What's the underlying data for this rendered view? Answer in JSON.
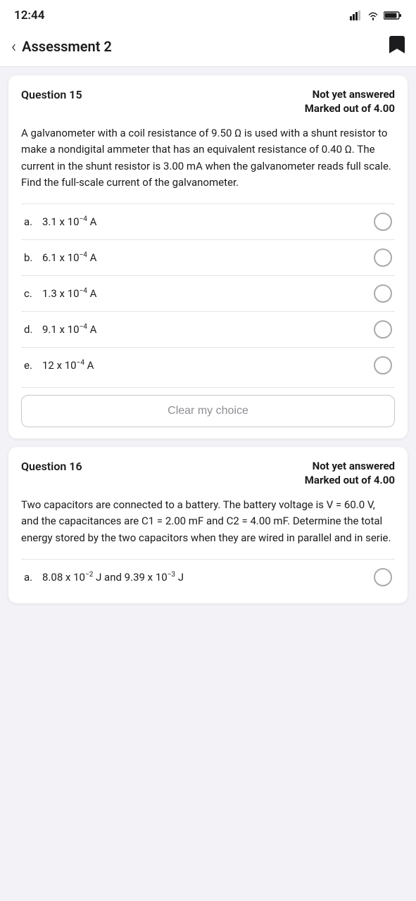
{
  "statusBar": {
    "time": "12:44",
    "icons": [
      "signal",
      "wifi",
      "battery"
    ]
  },
  "header": {
    "backLabel": "<",
    "title": "Assessment 2",
    "bookmarkIcon": "bookmark"
  },
  "question15": {
    "label": "Question 15",
    "statusLine1": "Not yet answered",
    "statusLine2": "Marked out of 4.00",
    "questionText": "A galvanometer with a coil resistance of 9.50 Ω is used with a shunt resistor to make a nondigital ammeter that has an equivalent resistance of 0.40 Ω. The current in the shunt resistor is 3.00 mA when the galvanometer reads full scale. Find the full-scale current of the galvanometer.",
    "options": [
      {
        "letter": "a.",
        "text": "3.1 x 10⁻⁴ A"
      },
      {
        "letter": "b.",
        "text": "6.1 x 10⁻⁴ A"
      },
      {
        "letter": "c.",
        "text": "1.3 x 10⁻⁴ A"
      },
      {
        "letter": "d.",
        "text": "9.1 x 10⁻⁴ A"
      },
      {
        "letter": "e.",
        "text": "12 x 10⁻⁴ A"
      }
    ],
    "clearButtonLabel": "Clear my choice"
  },
  "question16": {
    "label": "Question 16",
    "statusLine1": "Not yet answered",
    "statusLine2": "Marked out of 4.00",
    "questionText": "Two capacitors are connected to a battery. The battery voltage is V = 60.0 V, and the capacitances are C1 = 2.00 mF and C2 = 4.00 mF. Determine the total energy stored by the two capacitors when they are wired in parallel and in serie.",
    "options": [
      {
        "letter": "a.",
        "text": "8.08 x 10⁻² J and 9.39 x 10⁻³ J"
      }
    ]
  }
}
